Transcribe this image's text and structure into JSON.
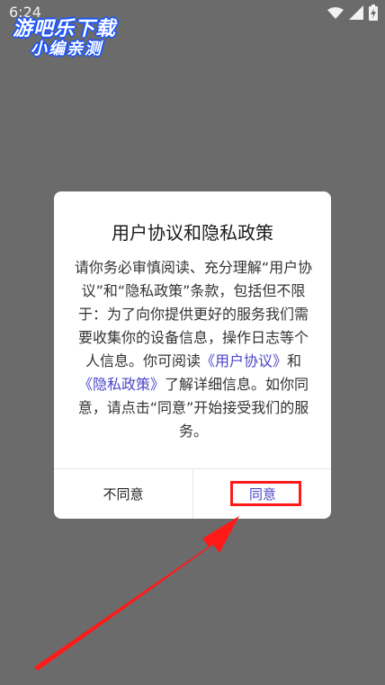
{
  "status_bar": {
    "time": "6:24"
  },
  "watermark": {
    "line1": "游吧乐下载",
    "line2": "小编亲测"
  },
  "dialog": {
    "title": "用户协议和隐私政策",
    "body_part1": "请你务必审慎阅读、充分理解“用户协议”和“隐私政策”条款，包括但不限于：为了向你提供更好的服务我们需要收集你的设备信息，操作日志等个人信息。你可阅读",
    "link_user_agreement": "《用户协议》",
    "body_and": "和",
    "link_privacy_policy": "《隐私政策》",
    "body_part2": "了解详细信息。如你同意，请点击“同意”开始接受我们的服务。",
    "disagree_label": "不同意",
    "agree_label": "同意"
  },
  "colors": {
    "link": "#4b44c9",
    "annotation": "#ff1a1a",
    "overlay": "#6b6b6b"
  }
}
